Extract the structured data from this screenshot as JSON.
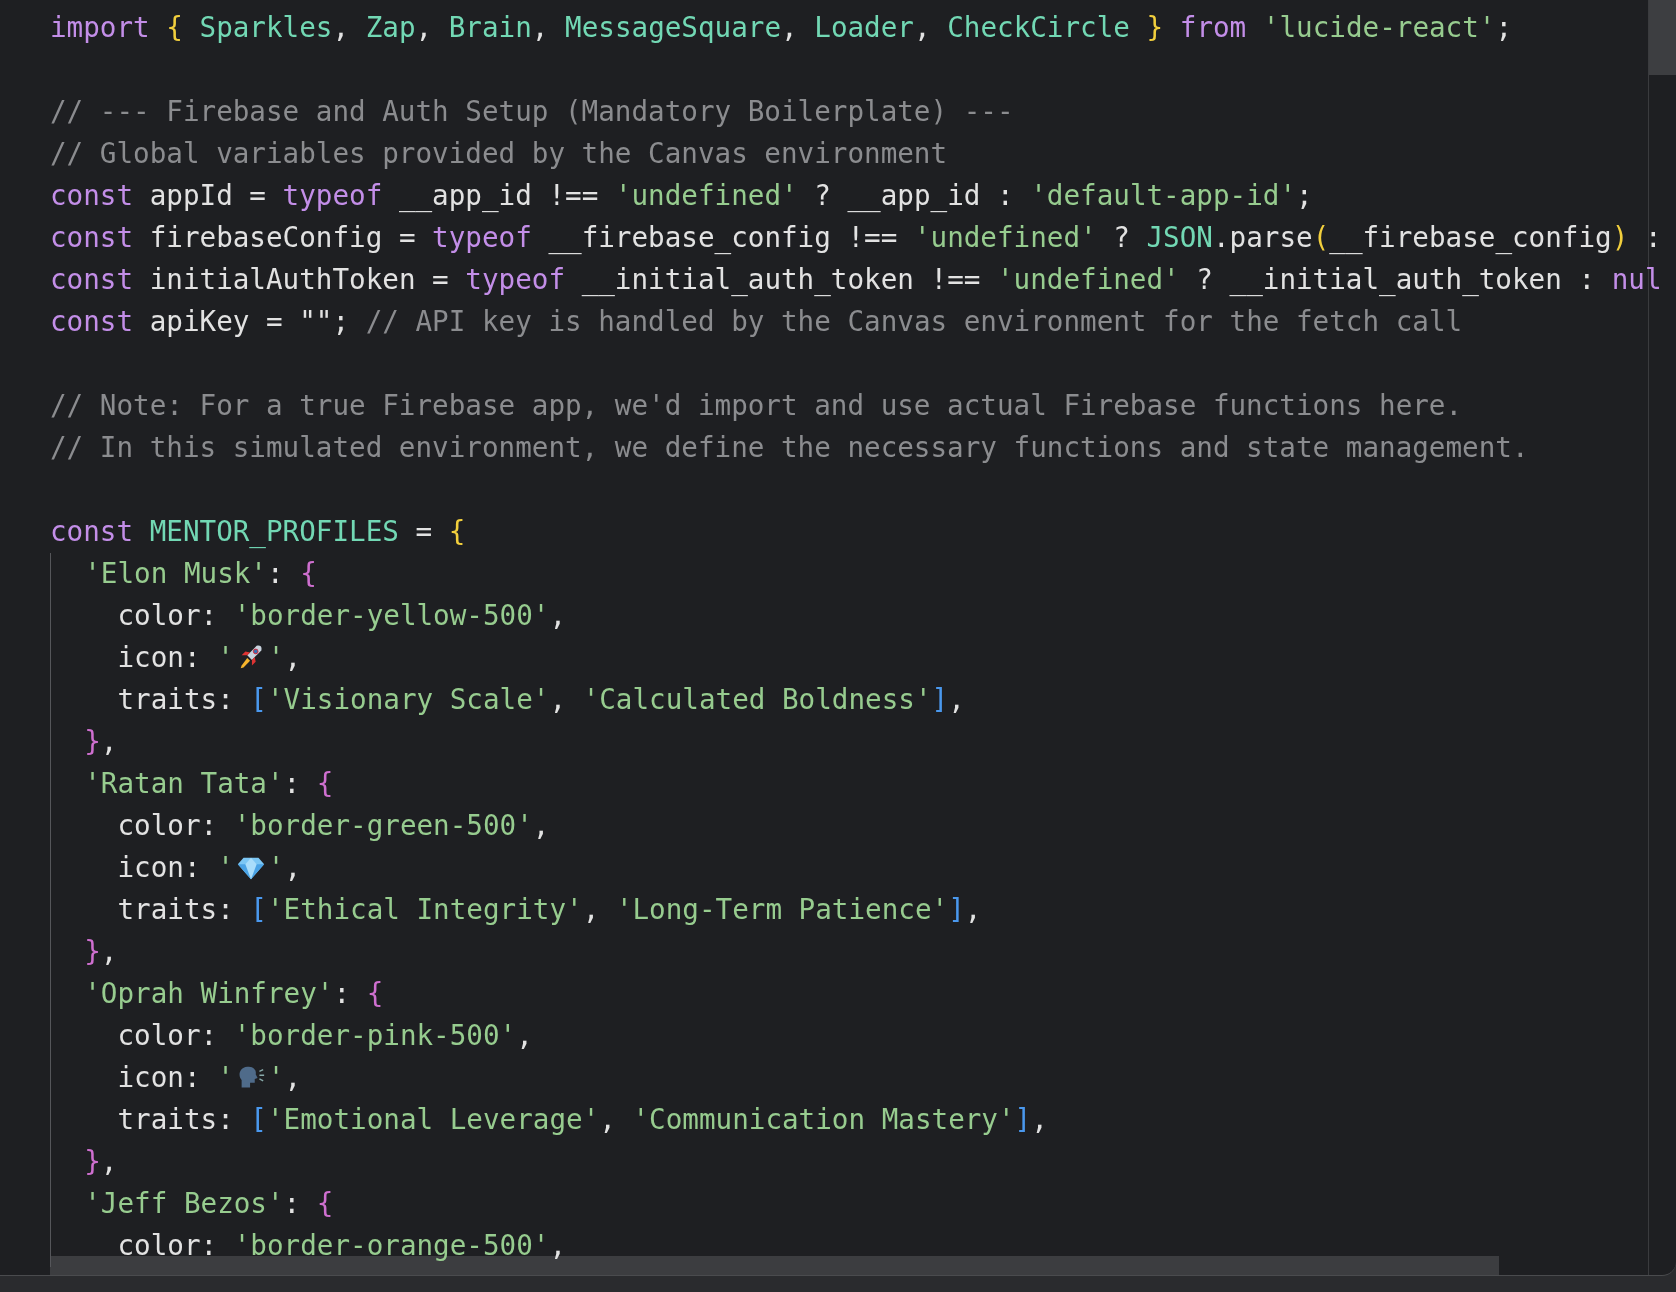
{
  "editor": {
    "lines": [
      {
        "tokens": [
          {
            "kind": "keyword",
            "text": "import"
          },
          {
            "kind": "brace1",
            "text": " {"
          },
          {
            "kind": "ident",
            "text": " Sparkles"
          },
          {
            "kind": "plain",
            "text": ", "
          },
          {
            "kind": "ident",
            "text": "Zap"
          },
          {
            "kind": "plain",
            "text": ", "
          },
          {
            "kind": "ident",
            "text": "Brain"
          },
          {
            "kind": "plain",
            "text": ", "
          },
          {
            "kind": "ident",
            "text": "MessageSquare"
          },
          {
            "kind": "plain",
            "text": ", "
          },
          {
            "kind": "ident",
            "text": "Loader"
          },
          {
            "kind": "plain",
            "text": ", "
          },
          {
            "kind": "ident",
            "text": "CheckCircle"
          },
          {
            "kind": "brace1",
            "text": " }"
          },
          {
            "kind": "keyword",
            "text": " from"
          },
          {
            "kind": "string",
            "text": " 'lucide-react'"
          },
          {
            "kind": "plain",
            "text": ";"
          }
        ]
      },
      {
        "kind": "blank"
      },
      {
        "tokens": [
          {
            "kind": "comment",
            "text": "// --- Firebase and Auth Setup (Mandatory Boilerplate) ---"
          }
        ]
      },
      {
        "tokens": [
          {
            "kind": "comment",
            "text": "// Global variables provided by the Canvas environment"
          }
        ]
      },
      {
        "tokens": [
          {
            "kind": "keyword",
            "text": "const"
          },
          {
            "kind": "plain",
            "text": " appId = "
          },
          {
            "kind": "keyword",
            "text": "typeof"
          },
          {
            "kind": "plain",
            "text": " __app_id !== "
          },
          {
            "kind": "string",
            "text": "'undefined'"
          },
          {
            "kind": "plain",
            "text": " ? __app_id : "
          },
          {
            "kind": "string",
            "text": "'default-app-id'"
          },
          {
            "kind": "plain",
            "text": ";"
          }
        ]
      },
      {
        "tokens": [
          {
            "kind": "keyword",
            "text": "const"
          },
          {
            "kind": "plain",
            "text": " firebaseConfig = "
          },
          {
            "kind": "keyword",
            "text": "typeof"
          },
          {
            "kind": "plain",
            "text": " __firebase_config !== "
          },
          {
            "kind": "string",
            "text": "'undefined'"
          },
          {
            "kind": "plain",
            "text": " ? "
          },
          {
            "kind": "ident",
            "text": "JSON"
          },
          {
            "kind": "plain",
            "text": ".parse"
          },
          {
            "kind": "brace1",
            "text": "("
          },
          {
            "kind": "plain",
            "text": "__firebase_config"
          },
          {
            "kind": "brace1",
            "text": ")"
          },
          {
            "kind": "plain",
            "text": " :"
          }
        ]
      },
      {
        "tokens": [
          {
            "kind": "keyword",
            "text": "const"
          },
          {
            "kind": "plain",
            "text": " initialAuthToken = "
          },
          {
            "kind": "keyword",
            "text": "typeof"
          },
          {
            "kind": "plain",
            "text": " __initial_auth_token !== "
          },
          {
            "kind": "string",
            "text": "'undefined'"
          },
          {
            "kind": "plain",
            "text": " ? __initial_auth_token : "
          },
          {
            "kind": "keyword",
            "text": "nul"
          }
        ]
      },
      {
        "tokens": [
          {
            "kind": "keyword",
            "text": "const"
          },
          {
            "kind": "plain",
            "text": " apiKey = \"\"; "
          },
          {
            "kind": "comment",
            "text": "// API key is handled by the Canvas environment for the fetch call"
          }
        ]
      },
      {
        "kind": "blank"
      },
      {
        "tokens": [
          {
            "kind": "comment",
            "text": "// Note: For a true Firebase app, we'd import and use actual Firebase functions here."
          }
        ]
      },
      {
        "tokens": [
          {
            "kind": "comment",
            "text": "// In this simulated environment, we define the necessary functions and state management."
          }
        ]
      },
      {
        "kind": "blank"
      },
      {
        "tokens": [
          {
            "kind": "keyword",
            "text": "const"
          },
          {
            "kind": "ident",
            "text": " MENTOR_PROFILES"
          },
          {
            "kind": "plain",
            "text": " = "
          },
          {
            "kind": "brace1",
            "text": "{"
          }
        ],
        "children": [
          {
            "tokens": [
              {
                "kind": "string",
                "text": "  'Elon Musk'"
              },
              {
                "kind": "plain",
                "text": ": "
              },
              {
                "kind": "brace2",
                "text": "{"
              }
            ]
          },
          {
            "tokens": [
              {
                "kind": "plain",
                "text": "    color: "
              },
              {
                "kind": "string",
                "text": "'border-yellow-500'"
              },
              {
                "kind": "plain",
                "text": ","
              }
            ]
          },
          {
            "tokens": [
              {
                "kind": "plain",
                "text": "    icon: "
              },
              {
                "kind": "string",
                "text": "'"
              },
              {
                "kind": "icon"
              },
              {
                "kind": "string",
                "text": "'"
              },
              {
                "kind": "plain",
                "text": ","
              }
            ]
          },
          {
            "tokens": [
              {
                "kind": "plain",
                "text": "    traits: "
              },
              {
                "kind": "brace3",
                "text": "["
              },
              {
                "kind": "string",
                "text": "'Visionary Scale'"
              },
              {
                "kind": "plain",
                "text": ", "
              },
              {
                "kind": "string",
                "text": "'Calculated Boldness'"
              },
              {
                "kind": "brace3",
                "text": "]"
              },
              {
                "kind": "plain",
                "text": ","
              }
            ]
          },
          {
            "tokens": [
              {
                "kind": "brace2",
                "text": "  }"
              },
              {
                "kind": "plain",
                "text": ","
              }
            ]
          },
          {
            "tokens": [
              {
                "kind": "string",
                "text": "  'Ratan Tata'"
              },
              {
                "kind": "plain",
                "text": ": "
              },
              {
                "kind": "brace2",
                "text": "{"
              }
            ]
          },
          {
            "tokens": [
              {
                "kind": "plain",
                "text": "    color: "
              },
              {
                "kind": "string",
                "text": "'border-green-500'"
              },
              {
                "kind": "plain",
                "text": ","
              }
            ]
          },
          {
            "tokens": [
              {
                "kind": "plain",
                "text": "    icon: "
              },
              {
                "kind": "string",
                "text": "'"
              },
              {
                "kind": "icon"
              },
              {
                "kind": "string",
                "text": "'"
              },
              {
                "kind": "plain",
                "text": ","
              }
            ]
          },
          {
            "tokens": [
              {
                "kind": "plain",
                "text": "    traits: "
              },
              {
                "kind": "brace3",
                "text": "["
              },
              {
                "kind": "string",
                "text": "'Ethical Integrity'"
              },
              {
                "kind": "plain",
                "text": ", "
              },
              {
                "kind": "string",
                "text": "'Long-Term Patience'"
              },
              {
                "kind": "brace3",
                "text": "]"
              },
              {
                "kind": "plain",
                "text": ","
              }
            ]
          },
          {
            "tokens": [
              {
                "kind": "brace2",
                "text": "  }"
              },
              {
                "kind": "plain",
                "text": ","
              }
            ]
          },
          {
            "tokens": [
              {
                "kind": "string",
                "text": "  'Oprah Winfrey'"
              },
              {
                "kind": "plain",
                "text": ": "
              },
              {
                "kind": "brace2",
                "text": "{"
              }
            ]
          },
          {
            "tokens": [
              {
                "kind": "plain",
                "text": "    color: "
              },
              {
                "kind": "string",
                "text": "'border-pink-500'"
              },
              {
                "kind": "plain",
                "text": ","
              }
            ]
          },
          {
            "tokens": [
              {
                "kind": "plain",
                "text": "    icon: "
              },
              {
                "kind": "string",
                "text": "'"
              },
              {
                "kind": "icon"
              },
              {
                "kind": "string",
                "text": "'"
              },
              {
                "kind": "plain",
                "text": ","
              }
            ]
          },
          {
            "tokens": [
              {
                "kind": "plain",
                "text": "    traits: "
              },
              {
                "kind": "brace3",
                "text": "["
              },
              {
                "kind": "string",
                "text": "'Emotional Leverage'"
              },
              {
                "kind": "plain",
                "text": ", "
              },
              {
                "kind": "string",
                "text": "'Communication Mastery'"
              },
              {
                "kind": "brace3",
                "text": "]"
              },
              {
                "kind": "plain",
                "text": ","
              }
            ]
          },
          {
            "tokens": [
              {
                "kind": "brace2",
                "text": "  }"
              },
              {
                "kind": "plain",
                "text": ","
              }
            ]
          },
          {
            "tokens": [
              {
                "kind": "string",
                "text": "  'Jeff Bezos'"
              },
              {
                "kind": "plain",
                "text": ": "
              },
              {
                "kind": "brace2",
                "text": "{"
              }
            ]
          },
          {
            "tokens": [
              {
                "kind": "plain",
                "text": "    color: "
              },
              {
                "kind": "string",
                "text": "'border-orange-500'"
              },
              {
                "kind": "plain",
                "text": ","
              }
            ]
          }
        ]
      }
    ]
  }
}
